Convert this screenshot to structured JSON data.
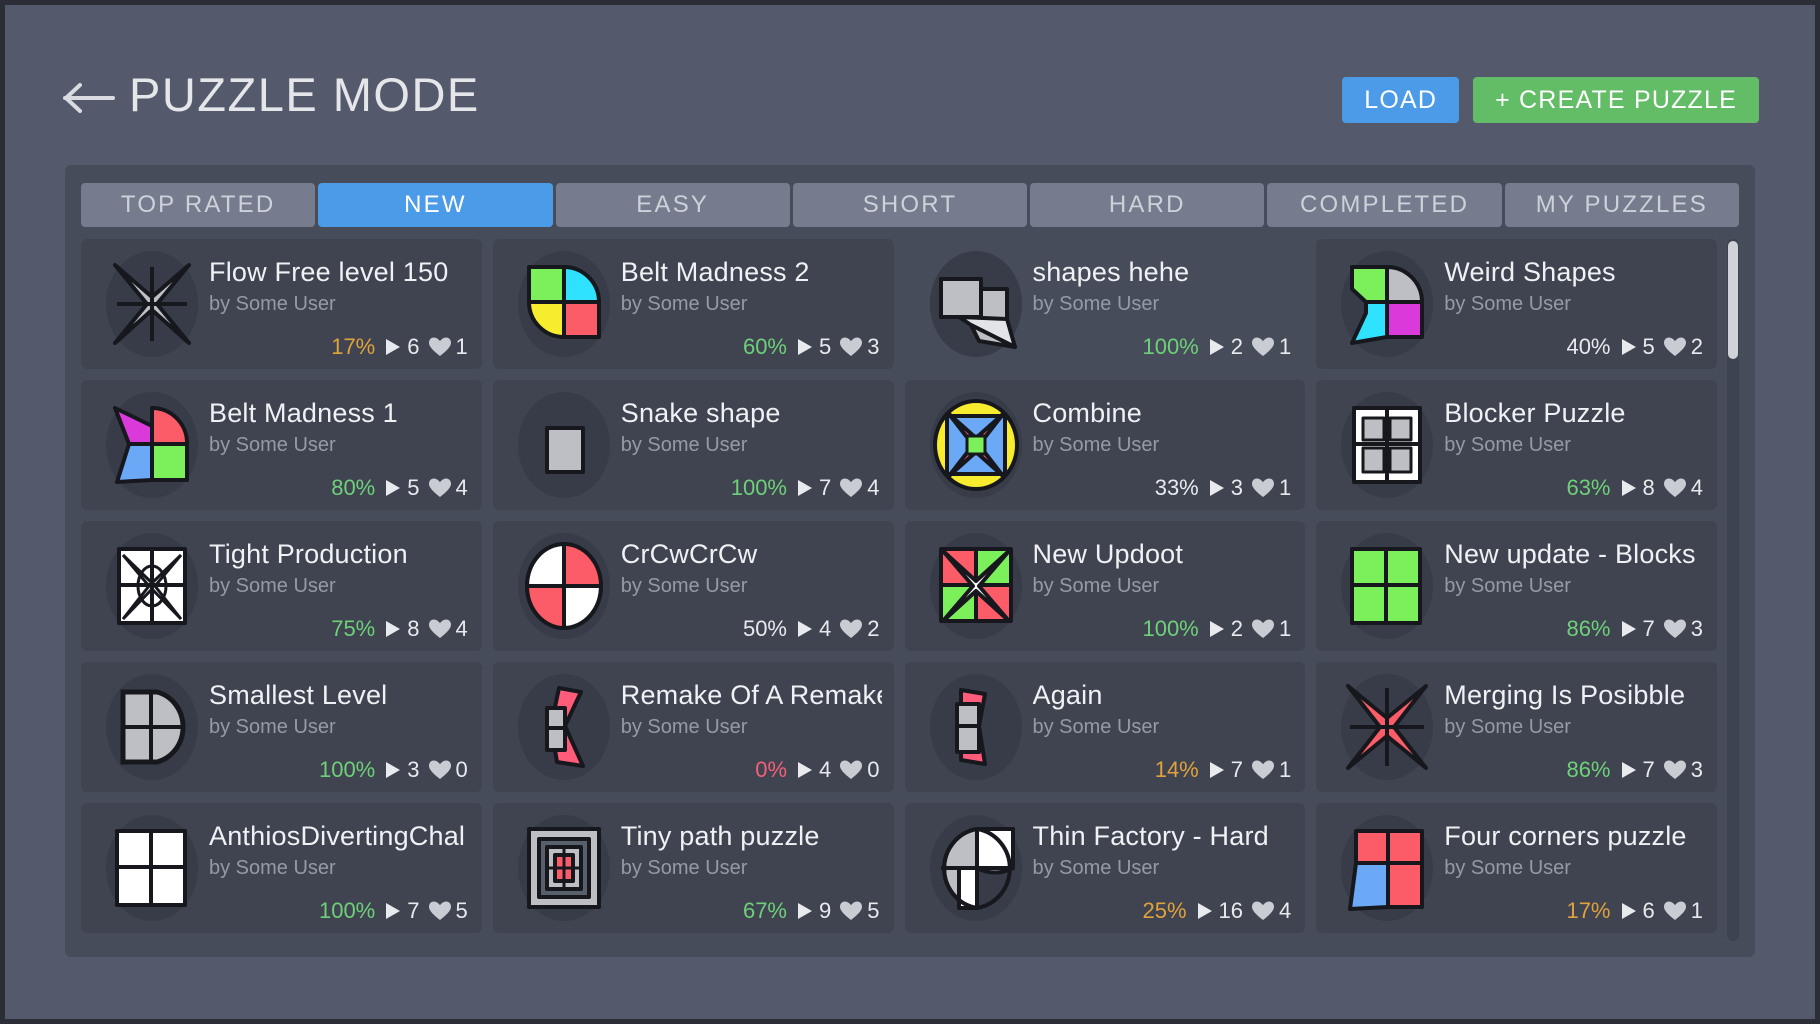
{
  "header": {
    "back_icon": "arrow-left-icon",
    "title": "PUZZLE MODE",
    "load_label": "LOAD",
    "create_label": "+ CREATE PUZZLE",
    "load_color": "#4c9be8",
    "create_color": "#63bd67"
  },
  "tabs": [
    {
      "label": "TOP RATED",
      "active": false
    },
    {
      "label": "NEW",
      "active": true
    },
    {
      "label": "EASY",
      "active": false
    },
    {
      "label": "SHORT",
      "active": false
    },
    {
      "label": "HARD",
      "active": false
    },
    {
      "label": "COMPLETED",
      "active": false
    },
    {
      "label": "MY PUZZLES",
      "active": false
    }
  ],
  "stats_icons": {
    "plays": "play-icon",
    "likes": "heart-icon"
  },
  "author_prefix": "by ",
  "puzzles": [
    {
      "title": "Flow Free level 150",
      "author": "by Some User",
      "percent": "17%",
      "pct_class": "mid",
      "plays": "6",
      "likes": "1",
      "thumb": "star-grey",
      "card_style": "filled"
    },
    {
      "title": "Belt Madness 2",
      "author": "by Some User",
      "percent": "60%",
      "pct_class": "good",
      "plays": "5",
      "likes": "3",
      "thumb": "quad-colors",
      "card_style": "filled"
    },
    {
      "title": "shapes hehe",
      "author": "by Some User",
      "percent": "100%",
      "pct_class": "good",
      "plays": "2",
      "likes": "1",
      "thumb": "shapes-grey",
      "card_style": "plain"
    },
    {
      "title": "Weird Shapes",
      "author": "by Some User",
      "percent": "40%",
      "pct_class": "neutral",
      "plays": "5",
      "likes": "2",
      "thumb": "weird-shapes",
      "card_style": "filled"
    },
    {
      "title": "Belt Madness 1",
      "author": "by Some User",
      "percent": "80%",
      "pct_class": "good",
      "plays": "5",
      "likes": "4",
      "thumb": "belt1",
      "card_style": "filled"
    },
    {
      "title": "Snake shape",
      "author": "by Some User",
      "percent": "100%",
      "pct_class": "good",
      "plays": "7",
      "likes": "4",
      "thumb": "single-square",
      "card_style": "filled"
    },
    {
      "title": "Combine",
      "author": "by Some User",
      "percent": "33%",
      "pct_class": "neutral",
      "plays": "3",
      "likes": "1",
      "thumb": "combine",
      "card_style": "filled"
    },
    {
      "title": "Blocker Puzzle",
      "author": "by Some User",
      "percent": "63%",
      "pct_class": "good",
      "plays": "8",
      "likes": "4",
      "thumb": "blocker",
      "card_style": "filled"
    },
    {
      "title": "Tight Production",
      "author": "by Some User",
      "percent": "75%",
      "pct_class": "good",
      "plays": "8",
      "likes": "4",
      "thumb": "tight",
      "card_style": "filled"
    },
    {
      "title": "CrCwCrCw",
      "author": "by Some User",
      "percent": "50%",
      "pct_class": "neutral",
      "plays": "4",
      "likes": "2",
      "thumb": "crcw",
      "card_style": "filled"
    },
    {
      "title": "New Updoot",
      "author": "by Some User",
      "percent": "100%",
      "pct_class": "good",
      "plays": "2",
      "likes": "1",
      "thumb": "updoot",
      "card_style": "filled"
    },
    {
      "title": "New update - Blocks",
      "author": "by Some User",
      "percent": "86%",
      "pct_class": "good",
      "plays": "7",
      "likes": "3",
      "thumb": "green-quad",
      "card_style": "filled"
    },
    {
      "title": "Smallest Level",
      "author": "by Some User",
      "percent": "100%",
      "pct_class": "good",
      "plays": "3",
      "likes": "0",
      "thumb": "smallest",
      "card_style": "filled"
    },
    {
      "title": "Remake Of A Remake",
      "author": "by Some User",
      "percent": "0%",
      "pct_class": "bad",
      "plays": "4",
      "likes": "0",
      "thumb": "remake",
      "card_style": "filled"
    },
    {
      "title": "Again",
      "author": "by Some User",
      "percent": "14%",
      "pct_class": "mid",
      "plays": "7",
      "likes": "1",
      "thumb": "again",
      "card_style": "filled"
    },
    {
      "title": "Merging Is Posibble",
      "author": "by Some User",
      "percent": "86%",
      "pct_class": "good",
      "plays": "7",
      "likes": "3",
      "thumb": "red-star",
      "card_style": "filled"
    },
    {
      "title": "AnthiosDivertingChal",
      "author": "by Some User",
      "percent": "100%",
      "pct_class": "good",
      "plays": "7",
      "likes": "5",
      "thumb": "white-quad",
      "card_style": "filled"
    },
    {
      "title": "Tiny path puzzle",
      "author": "by Some User",
      "percent": "67%",
      "pct_class": "good",
      "plays": "9",
      "likes": "5",
      "thumb": "tiny-path",
      "card_style": "filled"
    },
    {
      "title": "Thin Factory - Hard",
      "author": "by Some User",
      "percent": "25%",
      "pct_class": "mid",
      "plays": "16",
      "likes": "4",
      "thumb": "thin-factory",
      "card_style": "filled"
    },
    {
      "title": "Four corners puzzle",
      "author": "by Some User",
      "percent": "17%",
      "pct_class": "mid",
      "plays": "6",
      "likes": "1",
      "thumb": "four-corners",
      "card_style": "filled"
    }
  ],
  "scrollbar": {
    "name": "vertical-scrollbar"
  }
}
